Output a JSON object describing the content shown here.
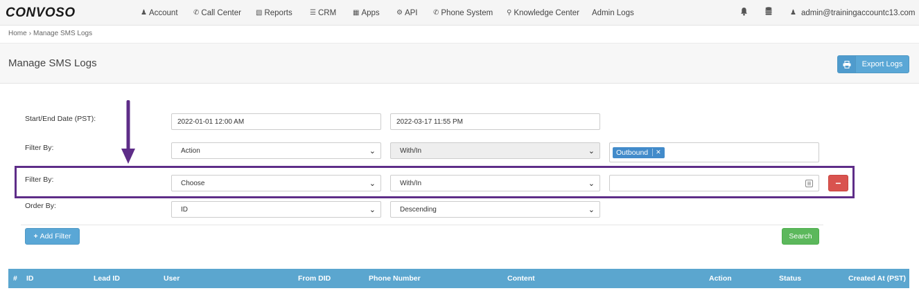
{
  "brand": {
    "logo_text": "CONVOSO"
  },
  "nav": {
    "items": [
      {
        "icon": "user-icon",
        "label": "Account"
      },
      {
        "icon": "phone-icon",
        "label": "Call Center"
      },
      {
        "icon": "bar-chart-icon",
        "label": "Reports"
      },
      {
        "icon": "list-icon",
        "label": "CRM"
      },
      {
        "icon": "grid-icon",
        "label": "Apps"
      },
      {
        "icon": "gear-icon",
        "label": "API"
      },
      {
        "icon": "phone-icon",
        "label": "Phone System"
      },
      {
        "icon": "lightbulb-icon",
        "label": "Knowledge Center"
      },
      {
        "icon": "",
        "label": "Admin Logs"
      }
    ],
    "user_email": "admin@trainingaccountc13.com"
  },
  "breadcrumb": {
    "home": "Home",
    "separator": "›",
    "current": "Manage SMS Logs"
  },
  "page": {
    "title": "Manage SMS Logs",
    "export_label": "Export Logs"
  },
  "form": {
    "date_label": "Start/End Date (PST):",
    "start_date": "2022-01-01 12:00 AM",
    "end_date": "2022-03-17 11:55 PM",
    "filters": [
      {
        "label": "Filter By:",
        "field": "Action",
        "operator": "With/In",
        "tags": [
          "Outbound"
        ]
      },
      {
        "label": "Filter By:",
        "field": "Choose",
        "operator": "With/In",
        "value": ""
      }
    ],
    "order_label": "Order By:",
    "order_field": "ID",
    "order_direction": "Descending",
    "add_filter_label": "Add Filter",
    "search_label": "Search"
  },
  "table": {
    "columns": [
      "#",
      "ID",
      "Lead ID",
      "User",
      "From DID",
      "Phone Number",
      "Content",
      "Action",
      "Status",
      "Created At (PST)"
    ]
  },
  "colors": {
    "accent": "#5aa7d6",
    "highlight": "#5e2d88",
    "danger": "#d9534f",
    "success": "#5cb85c",
    "tag": "#428bca"
  }
}
